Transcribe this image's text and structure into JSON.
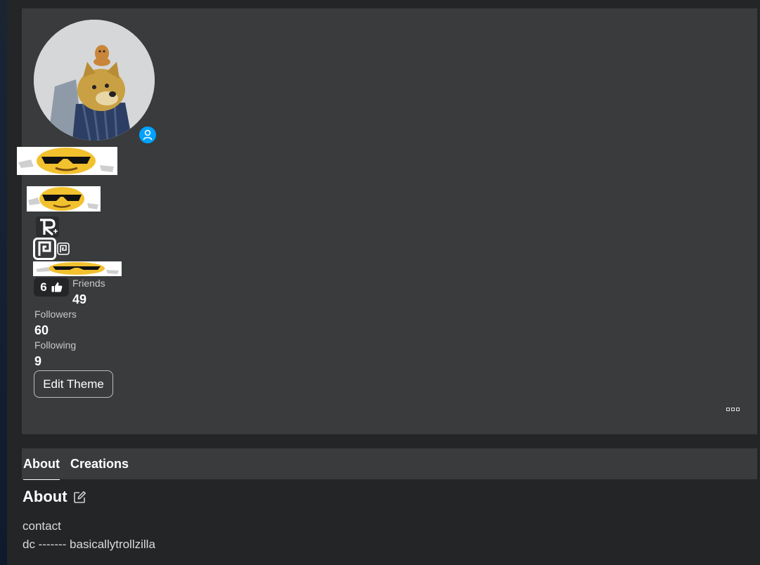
{
  "colors": {
    "page_bg": "#232527",
    "card_bg": "#393b3d",
    "presence_blue": "#00a2ff",
    "text_primary": "#ffffff",
    "text_secondary": "#c8c9cb"
  },
  "profile": {
    "avatar_icon": "avatar-image",
    "presence_icon": "user-presence-icon",
    "likes": "6",
    "stats": [
      {
        "label": "Friends",
        "value": "49"
      },
      {
        "label": "Followers",
        "value": "60"
      },
      {
        "label": "Following",
        "value": "9"
      }
    ],
    "edit_theme_label": "Edit Theme",
    "more_icon": "more-options-icon"
  },
  "tabs": [
    {
      "label": "About",
      "active": true
    },
    {
      "label": "Creations",
      "active": false
    }
  ],
  "about": {
    "title": "About",
    "edit_icon": "edit-icon",
    "lines": [
      "contact",
      "dc ------- basicallytrollzilla"
    ]
  }
}
